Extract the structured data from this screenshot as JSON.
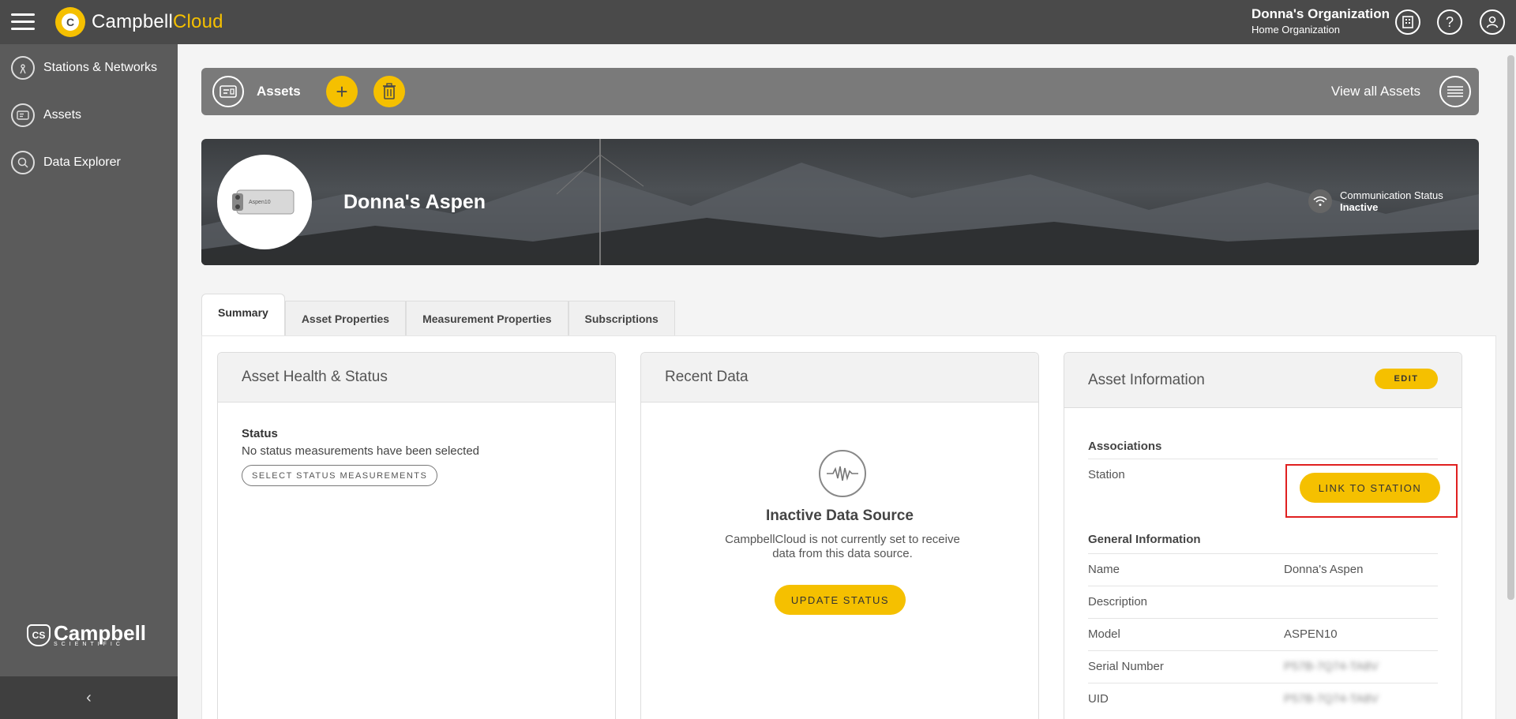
{
  "topbar": {
    "brand_part1": "Campbell",
    "brand_part2": "Cloud",
    "org_name": "Donna's Organization",
    "org_sub": "Home Organization"
  },
  "sidebar": {
    "items": [
      {
        "label": "Stations & Networks",
        "icon": "antenna-icon"
      },
      {
        "label": "Assets",
        "icon": "asset-icon"
      },
      {
        "label": "Data Explorer",
        "icon": "search-icon"
      }
    ],
    "brand_name": "Campbell",
    "brand_sub": "SCIENTIFIC",
    "brand_shield": "CS"
  },
  "assets_bar": {
    "title": "Assets",
    "view_all": "View all Assets"
  },
  "hero": {
    "asset_name": "Donna's Aspen",
    "device_label": "Aspen10",
    "comm_label": "Communication Status",
    "comm_value": "Inactive"
  },
  "tabs": [
    {
      "label": "Summary",
      "active": true
    },
    {
      "label": "Asset Properties",
      "active": false
    },
    {
      "label": "Measurement Properties",
      "active": false
    },
    {
      "label": "Subscriptions",
      "active": false
    }
  ],
  "health": {
    "title": "Asset Health & Status",
    "status_label": "Status",
    "status_text": "No status measurements have been selected",
    "button": "SELECT STATUS MEASUREMENTS"
  },
  "recent": {
    "title": "Recent Data",
    "state_title": "Inactive Data Source",
    "state_text": "CampbellCloud is not currently set to receive data from this data source.",
    "button": "UPDATE STATUS"
  },
  "asset_info": {
    "title": "Asset Information",
    "edit": "EDIT",
    "associations_label": "Associations",
    "station_label": "Station",
    "link_button": "LINK TO STATION",
    "general_label": "General Information",
    "rows": [
      {
        "key": "Name",
        "value": "Donna's Aspen"
      },
      {
        "key": "Description",
        "value": ""
      },
      {
        "key": "Model",
        "value": "ASPEN10"
      },
      {
        "key": "Serial Number",
        "value": "P57B-7Q74-TA8V"
      },
      {
        "key": "UID",
        "value": "P57B-7Q74-TA8V"
      }
    ]
  },
  "colors": {
    "accent": "#f5c000",
    "topbar": "#4a4a4a",
    "sidebar": "#5b5b5b"
  }
}
